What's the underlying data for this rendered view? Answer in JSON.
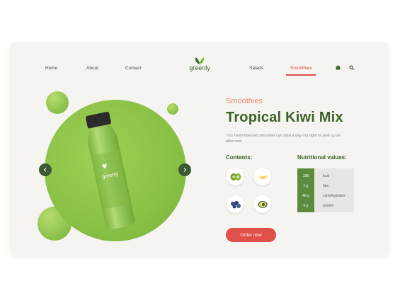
{
  "nav": {
    "left": [
      "Home",
      "About",
      "Contact"
    ],
    "right": [
      "Salads",
      "Smoothies"
    ],
    "active": "Smoothies"
  },
  "logo": {
    "text": "greenly"
  },
  "icons": {
    "cart": "shopping-bag-icon",
    "search": "search-icon",
    "prev": "chevron-left-icon",
    "next": "chevron-right-icon"
  },
  "product": {
    "category": "Smoothies",
    "title": "Tropical Kiwi Mix",
    "description": "This fresh-flavored smoothie can start a day out right or perk up an afternoon",
    "bottle_label": "greenly"
  },
  "contents": {
    "heading": "Contents:",
    "items": [
      "kiwi",
      "banana",
      "blueberries",
      "avocado"
    ]
  },
  "nutrition": {
    "heading": "Nutritional values:",
    "rows": [
      {
        "value": "196",
        "label": "kcal"
      },
      {
        "value": "1 g",
        "label": "fats"
      },
      {
        "value": "46 g",
        "label": "carbohydrates"
      },
      {
        "value": "5 g",
        "label": "protein"
      }
    ]
  },
  "order_button": "Order now",
  "colors": {
    "accent": "#e0504a",
    "brand_green": "#3d6228",
    "light_green": "#8cc34a",
    "background": "#f6f4f0"
  }
}
